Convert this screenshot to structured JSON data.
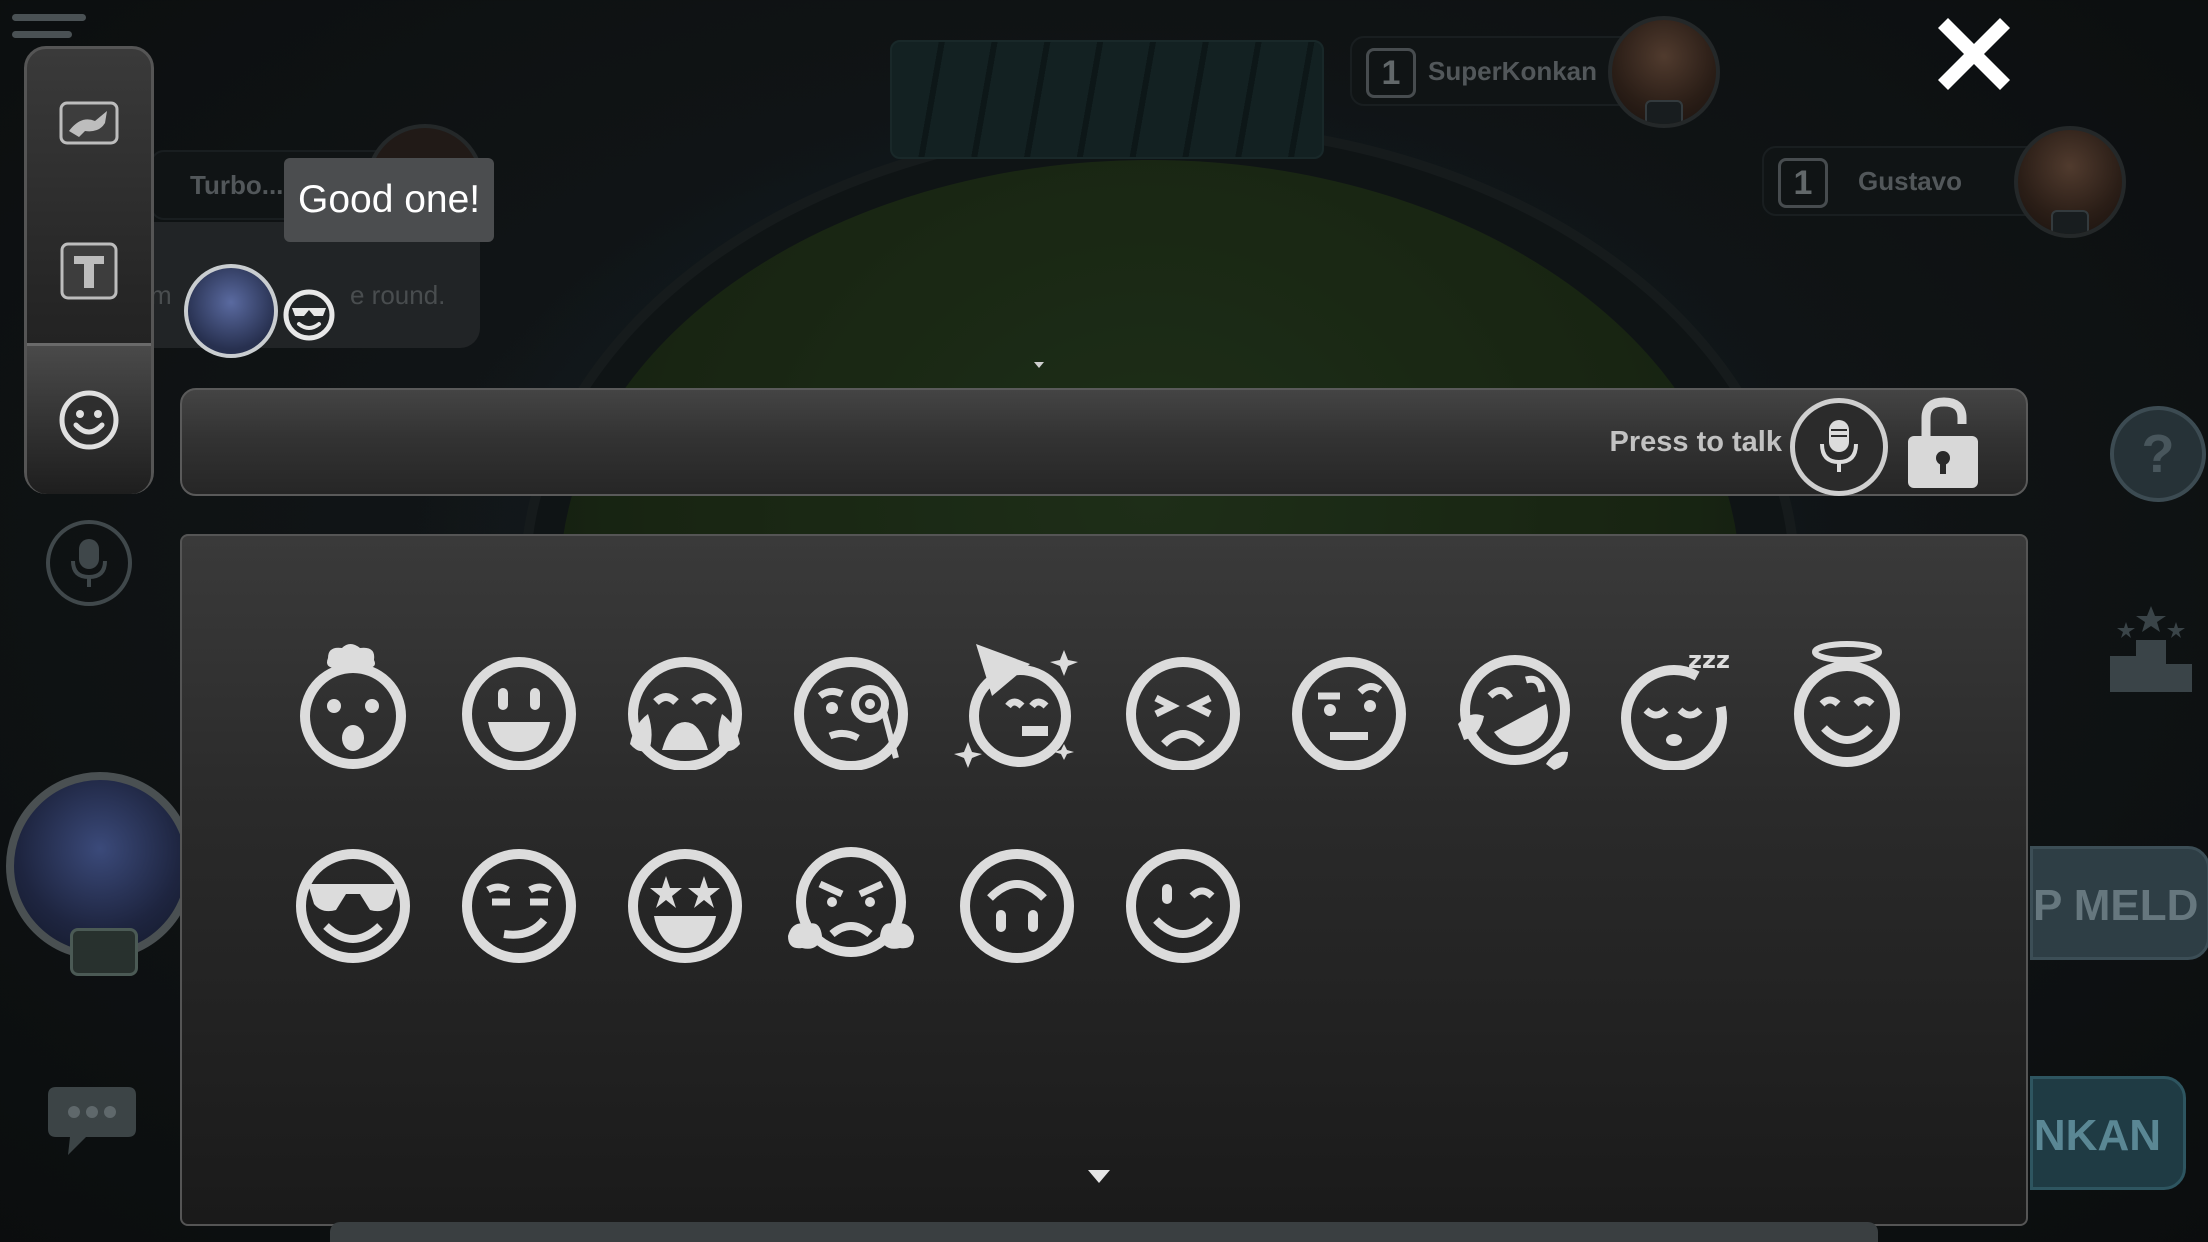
{
  "players": {
    "top": {
      "rank": "1",
      "name": "SuperKonkan"
    },
    "right": {
      "rank": "1",
      "name": "Gustavo"
    },
    "left": {
      "name": "Turbo..."
    }
  },
  "chat_preview": {
    "tooltip": "Good one!",
    "message_fragment_start": "m",
    "message_fragment_end": "e round."
  },
  "toolbar": {
    "tabs": [
      {
        "name": "quick-chat-tab",
        "icon": "rabbit-icon"
      },
      {
        "name": "text-chat-tab",
        "icon": "text-t-icon"
      },
      {
        "name": "emoji-tab",
        "icon": "smiley-icon",
        "active": true
      }
    ]
  },
  "voice": {
    "label": "Press to talk"
  },
  "emoji_panel": {
    "row1": [
      "exploding-head-icon",
      "grinning-face-icon",
      "loudly-crying-face-icon",
      "face-with-monocle-icon",
      "partying-face-icon",
      "persevering-face-icon",
      "face-with-raised-eyebrow-icon",
      "rolling-on-floor-laughing-icon",
      "sleeping-face-icon",
      "smiling-face-with-halo-icon"
    ],
    "row2": [
      "smiling-face-with-sunglasses-icon",
      "smirking-face-icon",
      "star-struck-icon",
      "face-with-steam-icon",
      "upside-down-face-icon",
      "winking-face-icon"
    ]
  },
  "right_buttons": {
    "help": "?",
    "meld": "P MELD",
    "konkan": "NKAN"
  }
}
